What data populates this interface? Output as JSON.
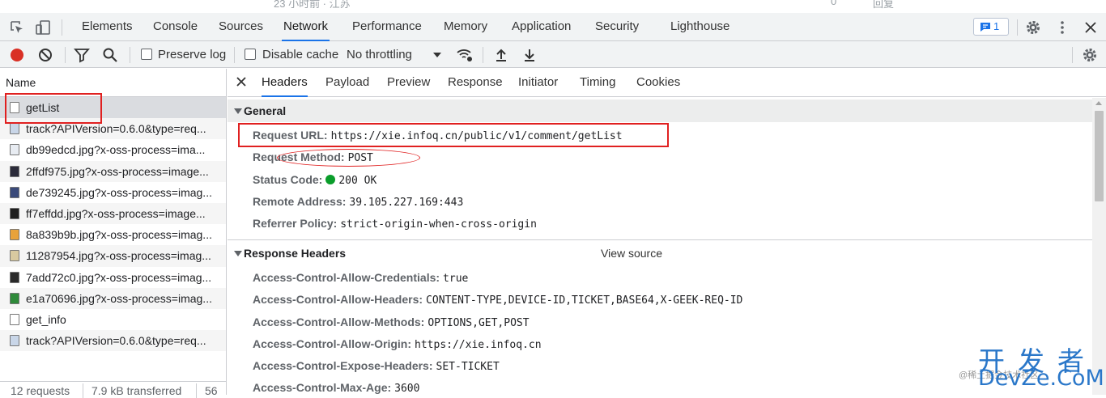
{
  "top_strip": {
    "left_text": "23 小时前 · 江苏",
    "likes": "0",
    "reply": "回复"
  },
  "tabs": [
    "Elements",
    "Console",
    "Sources",
    "Network",
    "Performance",
    "Memory",
    "Application",
    "Security",
    "Lighthouse"
  ],
  "active_tab": "Network",
  "issues_badge": "1",
  "toolbar": {
    "preserve_log": "Preserve log",
    "disable_cache": "Disable cache",
    "throttling": "No throttling"
  },
  "request_list": {
    "header": "Name",
    "rows": [
      {
        "name": "getList",
        "type": "doc",
        "color": ""
      },
      {
        "name": "track?APIVersion=0.6.0&type=req...",
        "type": "img",
        "color": "#c9d6e8"
      },
      {
        "name": "db99edcd.jpg?x-oss-process=ima...",
        "type": "img",
        "color": "#e8ecf2"
      },
      {
        "name": "2ffdf975.jpg?x-oss-process=image...",
        "type": "img",
        "color": "#2b2b3a"
      },
      {
        "name": "de739245.jpg?x-oss-process=imag...",
        "type": "img",
        "color": "#3a4a7a"
      },
      {
        "name": "ff7effdd.jpg?x-oss-process=image...",
        "type": "img",
        "color": "#1f1f1f"
      },
      {
        "name": "8a839b9b.jpg?x-oss-process=imag...",
        "type": "img",
        "color": "#e8a23a"
      },
      {
        "name": "11287954.jpg?x-oss-process=imag...",
        "type": "img",
        "color": "#d8c9a0"
      },
      {
        "name": "7add72c0.jpg?x-oss-process=imag...",
        "type": "img",
        "color": "#2a2a2a"
      },
      {
        "name": "e1a70696.jpg?x-oss-process=imag...",
        "type": "img",
        "color": "#2f8a3a"
      },
      {
        "name": "get_info",
        "type": "doc",
        "color": ""
      },
      {
        "name": "track?APIVersion=0.6.0&type=req...",
        "type": "img",
        "color": "#c9d6e8"
      }
    ],
    "footer": {
      "requests": "12 requests",
      "transferred": "7.9 kB transferred",
      "extra": "56"
    }
  },
  "detail_tabs": [
    "Headers",
    "Payload",
    "Preview",
    "Response",
    "Initiator",
    "Timing",
    "Cookies"
  ],
  "active_detail_tab": "Headers",
  "general": {
    "title": "General",
    "rows": [
      {
        "key": "Request URL:",
        "value": "https://xie.infoq.cn/public/v1/comment/getList"
      },
      {
        "key": "Request Method:",
        "value": "POST"
      },
      {
        "key": "Status Code:",
        "value": "200 OK"
      },
      {
        "key": "Remote Address:",
        "value": "39.105.227.169:443"
      },
      {
        "key": "Referrer Policy:",
        "value": "strict-origin-when-cross-origin"
      }
    ]
  },
  "response_headers": {
    "title": "Response Headers",
    "view_source": "View source",
    "rows": [
      {
        "key": "Access-Control-Allow-Credentials:",
        "value": "true"
      },
      {
        "key": "Access-Control-Allow-Headers:",
        "value": "CONTENT-TYPE,DEVICE-ID,TICKET,BASE64,X-GEEK-REQ-ID"
      },
      {
        "key": "Access-Control-Allow-Methods:",
        "value": "OPTIONS,GET,POST"
      },
      {
        "key": "Access-Control-Allow-Origin:",
        "value": "https://xie.infoq.cn"
      },
      {
        "key": "Access-Control-Expose-Headers:",
        "value": "SET-TICKET"
      },
      {
        "key": "Access-Control-Max-Age:",
        "value": "3600"
      }
    ]
  },
  "watermark": {
    "line1": "开发者",
    "line2": "DevZe.CoM",
    "line0": "@稀土掘金技术社区"
  },
  "colors": {
    "accent": "#1a73e8",
    "record": "#d93025",
    "annotation": "#e02020",
    "status_ok": "#0a9d2b"
  }
}
